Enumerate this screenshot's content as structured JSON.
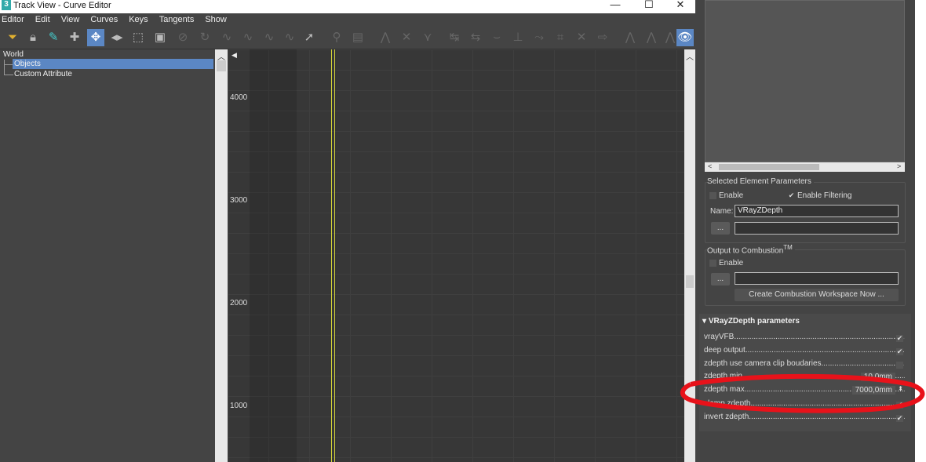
{
  "window": {
    "title": "Track View - Curve Editor",
    "app_icon": "3"
  },
  "menu": [
    "Editor",
    "Edit",
    "View",
    "Curves",
    "Keys",
    "Tangents",
    "Show"
  ],
  "tree": {
    "items": [
      "World",
      "Objects",
      "Custom Attribute"
    ],
    "selected": "Objects"
  },
  "curve": {
    "y_labels": [
      "4000",
      "3000",
      "2000",
      "1000"
    ],
    "time_slider_color": "#d8d83a"
  },
  "selected_element": {
    "title": "Selected Element Parameters",
    "enable": "Enable",
    "enable_filtering": "Enable Filtering",
    "name_label": "Name:",
    "name_value": "VRayZDepth",
    "browse": "..."
  },
  "combustion": {
    "title": "Output to  Combustion",
    "tm": "TM",
    "enable": "Enable",
    "browse": "...",
    "create_button": "Create Combustion Workspace Now ..."
  },
  "vray": {
    "title": "VRayZDepth parameters",
    "rows": [
      {
        "label": "vrayVFB",
        "checked": true
      },
      {
        "label": "deep output",
        "checked": true
      },
      {
        "label": "zdepth use camera clip boudaries",
        "checked": false
      },
      {
        "label": "zdepth min",
        "value": "10,0mm"
      },
      {
        "label": "zdepth max",
        "value": "7000,0mm"
      },
      {
        "label": "clamp zdepth",
        "checked": true
      },
      {
        "label": "invert zdepth",
        "checked": true
      }
    ]
  },
  "annotation_color": "#e8121a"
}
